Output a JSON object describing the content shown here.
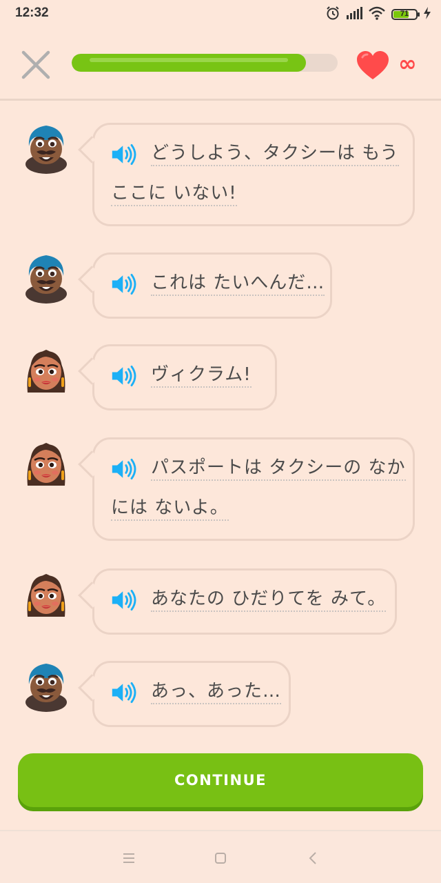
{
  "status_bar": {
    "time": "12:32",
    "battery_level": "71",
    "battery_fraction": 0.71,
    "icons": [
      "alarm-icon",
      "signal-icon",
      "wifi-icon",
      "battery-icon",
      "charging-icon"
    ]
  },
  "header": {
    "close_icon": "close-icon",
    "progress_fraction": 0.88,
    "hearts_icon": "heart-icon",
    "hearts_count": "∞"
  },
  "conversation": [
    {
      "speaker": "vikram",
      "lines": [
        "どうしよう、タクシーは もう",
        "ここに いない!"
      ]
    },
    {
      "speaker": "vikram",
      "lines": [
        "これは たいへんだ…"
      ]
    },
    {
      "speaker": "priti",
      "lines": [
        "ヴィクラム!"
      ]
    },
    {
      "speaker": "priti",
      "lines": [
        "パスポートは タクシーの なか",
        "には ないよ。"
      ]
    },
    {
      "speaker": "priti",
      "lines": [
        "あなたの ひだりてを みて。"
      ]
    },
    {
      "speaker": "vikram",
      "lines": [
        "あっ、あった…"
      ]
    }
  ],
  "continue_label": "CONTINUE",
  "colors": {
    "background": "#fde7da",
    "accent_green": "#78c014",
    "heart_red": "#ff4b4b",
    "speaker_blue": "#1cb0f6"
  },
  "nav_bar": [
    "menu-icon",
    "home-icon",
    "back-icon"
  ]
}
